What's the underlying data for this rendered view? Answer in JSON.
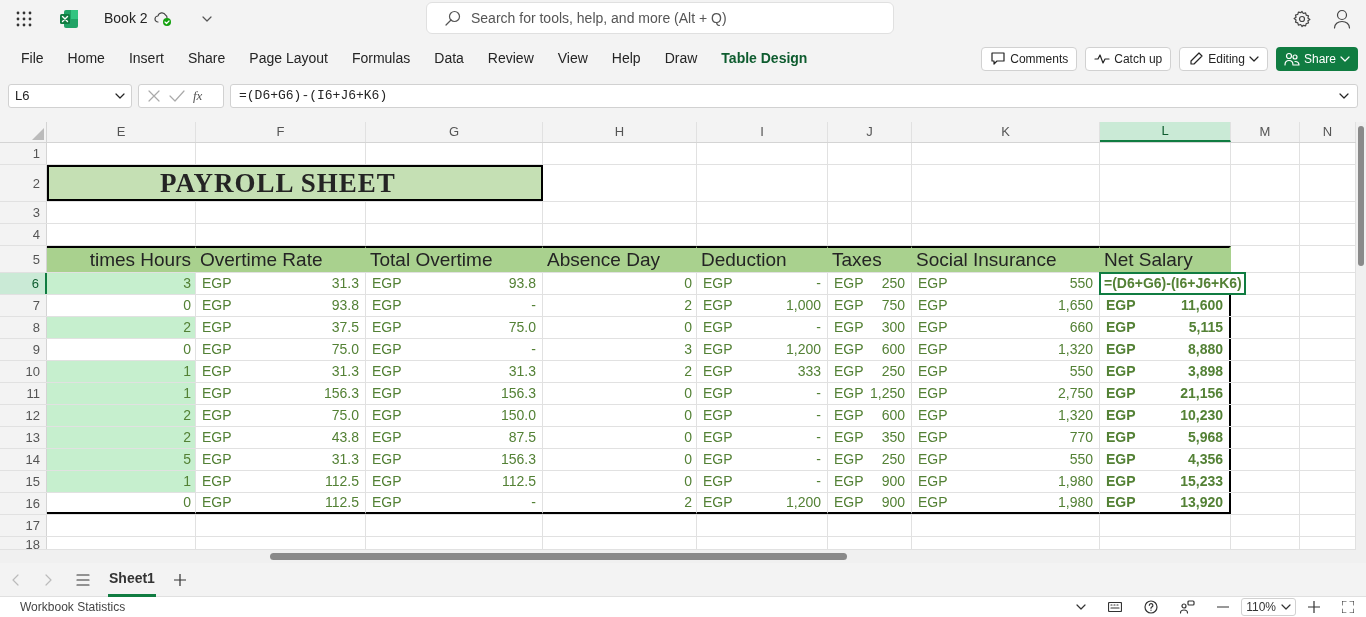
{
  "app": {
    "title": "Book 2",
    "search_placeholder": "Search for tools, help, and more (Alt + Q)"
  },
  "ribbon": {
    "tabs": [
      {
        "label": "File",
        "contextual": false
      },
      {
        "label": "Home",
        "contextual": false
      },
      {
        "label": "Insert",
        "contextual": false
      },
      {
        "label": "Share",
        "contextual": false
      },
      {
        "label": "Page Layout",
        "contextual": false
      },
      {
        "label": "Formulas",
        "contextual": false
      },
      {
        "label": "Data",
        "contextual": false
      },
      {
        "label": "Review",
        "contextual": false
      },
      {
        "label": "View",
        "contextual": false
      },
      {
        "label": "Help",
        "contextual": false
      },
      {
        "label": "Draw",
        "contextual": false
      },
      {
        "label": "Table Design",
        "contextual": true
      }
    ],
    "buttons": [
      {
        "kind": "comments",
        "label": "Comments"
      },
      {
        "kind": "catchup",
        "label": "Catch up"
      },
      {
        "kind": "editing",
        "label": "Editing"
      },
      {
        "kind": "share",
        "label": "Share"
      }
    ]
  },
  "formula_bar": {
    "name_box": "L6",
    "fx": "fx",
    "formula": "=(D6+G6)-(I6+J6+K6)"
  },
  "sheet": {
    "columns": [
      {
        "label": "E",
        "selected": false
      },
      {
        "label": "F",
        "selected": false
      },
      {
        "label": "G",
        "selected": false
      },
      {
        "label": "H",
        "selected": false
      },
      {
        "label": "I",
        "selected": false
      },
      {
        "label": "J",
        "selected": false
      },
      {
        "label": "K",
        "selected": false
      },
      {
        "label": "L",
        "selected": true
      },
      {
        "label": "M",
        "selected": false
      },
      {
        "label": "N",
        "selected": false
      }
    ],
    "title": "PAYROLL SHEET",
    "row_numbers": [
      {
        "label": "1",
        "selected": false
      },
      {
        "label": "2",
        "selected": false
      },
      {
        "label": "3",
        "selected": false
      },
      {
        "label": "4",
        "selected": false
      },
      {
        "label": "5",
        "selected": false
      },
      {
        "label": "6",
        "selected": true
      },
      {
        "label": "7",
        "selected": false
      },
      {
        "label": "8",
        "selected": false
      },
      {
        "label": "9",
        "selected": false
      },
      {
        "label": "10",
        "selected": false
      },
      {
        "label": "11",
        "selected": false
      },
      {
        "label": "12",
        "selected": false
      },
      {
        "label": "13",
        "selected": false
      },
      {
        "label": "14",
        "selected": false
      },
      {
        "label": "15",
        "selected": false
      },
      {
        "label": "16",
        "selected": false
      },
      {
        "label": "17",
        "selected": false
      },
      {
        "label": "18",
        "selected": false
      }
    ],
    "headers": [
      "times Hours",
      "Overtime Rate",
      "Total Overtime",
      "Absence Day",
      "Deduction",
      "Taxes",
      "Social Insurance",
      "Net Salary"
    ],
    "rows": [
      {
        "highlight": true,
        "hours": "3",
        "rate": [
          "EGP",
          "31.3"
        ],
        "total": [
          "EGP",
          "93.8"
        ],
        "absence": "0",
        "deduction": [
          "EGP",
          "-"
        ],
        "taxes": [
          "EGP",
          "250"
        ],
        "social": [
          "EGP",
          "550"
        ],
        "net_formula": "=(D6+G6)-(I6+J6+K6)"
      },
      {
        "highlight": false,
        "hours": "0",
        "rate": [
          "EGP",
          "93.8"
        ],
        "total": [
          "EGP",
          "-"
        ],
        "absence": "2",
        "deduction": [
          "EGP",
          "1,000"
        ],
        "taxes": [
          "EGP",
          "750"
        ],
        "social": [
          "EGP",
          "1,650"
        ],
        "net": [
          "EGP",
          "11,600"
        ]
      },
      {
        "highlight": true,
        "hours": "2",
        "rate": [
          "EGP",
          "37.5"
        ],
        "total": [
          "EGP",
          "75.0"
        ],
        "absence": "0",
        "deduction": [
          "EGP",
          "-"
        ],
        "taxes": [
          "EGP",
          "300"
        ],
        "social": [
          "EGP",
          "660"
        ],
        "net": [
          "EGP",
          "5,115"
        ]
      },
      {
        "highlight": false,
        "hours": "0",
        "rate": [
          "EGP",
          "75.0"
        ],
        "total": [
          "EGP",
          "-"
        ],
        "absence": "3",
        "deduction": [
          "EGP",
          "1,200"
        ],
        "taxes": [
          "EGP",
          "600"
        ],
        "social": [
          "EGP",
          "1,320"
        ],
        "net": [
          "EGP",
          "8,880"
        ]
      },
      {
        "highlight": true,
        "hours": "1",
        "rate": [
          "EGP",
          "31.3"
        ],
        "total": [
          "EGP",
          "31.3"
        ],
        "absence": "2",
        "deduction": [
          "EGP",
          "333"
        ],
        "taxes": [
          "EGP",
          "250"
        ],
        "social": [
          "EGP",
          "550"
        ],
        "net": [
          "EGP",
          "3,898"
        ]
      },
      {
        "highlight": true,
        "hours": "1",
        "rate": [
          "EGP",
          "156.3"
        ],
        "total": [
          "EGP",
          "156.3"
        ],
        "absence": "0",
        "deduction": [
          "EGP",
          "-"
        ],
        "taxes": [
          "EGP",
          "1,250"
        ],
        "social": [
          "EGP",
          "2,750"
        ],
        "net": [
          "EGP",
          "21,156"
        ]
      },
      {
        "highlight": true,
        "hours": "2",
        "rate": [
          "EGP",
          "75.0"
        ],
        "total": [
          "EGP",
          "150.0"
        ],
        "absence": "0",
        "deduction": [
          "EGP",
          "-"
        ],
        "taxes": [
          "EGP",
          "600"
        ],
        "social": [
          "EGP",
          "1,320"
        ],
        "net": [
          "EGP",
          "10,230"
        ]
      },
      {
        "highlight": true,
        "hours": "2",
        "rate": [
          "EGP",
          "43.8"
        ],
        "total": [
          "EGP",
          "87.5"
        ],
        "absence": "0",
        "deduction": [
          "EGP",
          "-"
        ],
        "taxes": [
          "EGP",
          "350"
        ],
        "social": [
          "EGP",
          "770"
        ],
        "net": [
          "EGP",
          "5,968"
        ]
      },
      {
        "highlight": true,
        "hours": "5",
        "rate": [
          "EGP",
          "31.3"
        ],
        "total": [
          "EGP",
          "156.3"
        ],
        "absence": "0",
        "deduction": [
          "EGP",
          "-"
        ],
        "taxes": [
          "EGP",
          "250"
        ],
        "social": [
          "EGP",
          "550"
        ],
        "net": [
          "EGP",
          "4,356"
        ]
      },
      {
        "highlight": true,
        "hours": "1",
        "rate": [
          "EGP",
          "112.5"
        ],
        "total": [
          "EGP",
          "112.5"
        ],
        "absence": "0",
        "deduction": [
          "EGP",
          "-"
        ],
        "taxes": [
          "EGP",
          "900"
        ],
        "social": [
          "EGP",
          "1,980"
        ],
        "net": [
          "EGP",
          "15,233"
        ]
      },
      {
        "highlight": false,
        "hours": "0",
        "rate": [
          "EGP",
          "112.5"
        ],
        "total": [
          "EGP",
          "-"
        ],
        "absence": "2",
        "deduction": [
          "EGP",
          "1,200"
        ],
        "taxes": [
          "EGP",
          "900"
        ],
        "social": [
          "EGP",
          "1,980"
        ],
        "net": [
          "EGP",
          "13,920"
        ]
      }
    ]
  },
  "sheet_tabs": [
    {
      "label": "Sheet1",
      "selected": true
    }
  ],
  "status_bar": {
    "left": "Workbook Statistics",
    "zoom": "110%"
  }
}
